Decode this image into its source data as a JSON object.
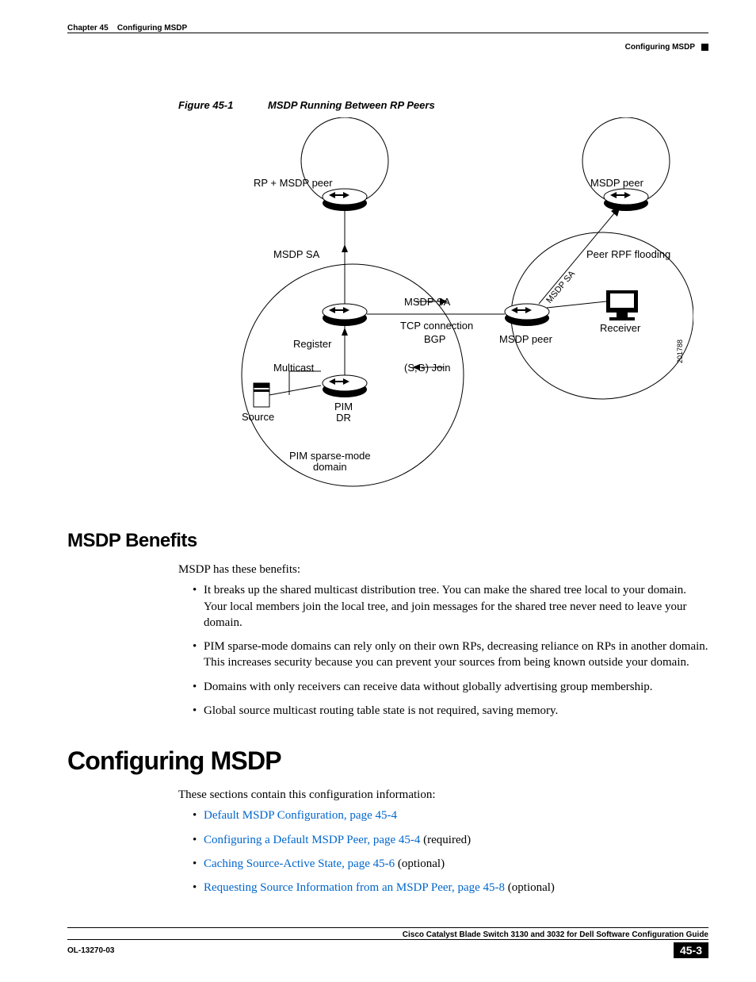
{
  "header": {
    "chapter": "Chapter 45",
    "chapter_title": "Configuring MSDP",
    "section": "Configuring MSDP"
  },
  "figure": {
    "number": "Figure 45-1",
    "title": "MSDP Running Between RP Peers",
    "labels": {
      "rp_msdp_peer": "RP + MSDP peer",
      "msdp_peer_top": "MSDP peer",
      "msdp_sa_left": "MSDP SA",
      "peer_rpf": "Peer RPF flooding",
      "msdp_sa_rot": "MSDP SA",
      "msdp_sa_mid": "MSDP SA",
      "tcp": "TCP connection",
      "bgp": "BGP",
      "msdp_peer_mid": "MSDP peer",
      "receiver": "Receiver",
      "register": "Register",
      "multicast": "Multicast",
      "sg_join": "(S,G) Join",
      "source": "Source",
      "pim_dr": "PIM\nDR",
      "pim_domain": "PIM sparse-mode\ndomain",
      "diagram_id": "201788"
    }
  },
  "benefits": {
    "heading": "MSDP Benefits",
    "intro": "MSDP has these benefits:",
    "items": [
      "It breaks up the shared multicast distribution tree. You can make the shared tree local to your domain. Your local members join the local tree, and join messages for the shared tree never need to leave your domain.",
      "PIM sparse-mode domains can rely only on their own RPs, decreasing reliance on RPs in another domain. This increases security because you can prevent your sources from being known outside your domain.",
      "Domains with only receivers can receive data without globally advertising group membership.",
      "Global source multicast routing table state is not required, saving memory."
    ]
  },
  "configuring": {
    "heading": "Configuring MSDP",
    "intro": "These sections contain this configuration information:",
    "items": [
      {
        "link": "Default MSDP Configuration, page 45-4",
        "suffix": ""
      },
      {
        "link": "Configuring a Default MSDP Peer, page 45-4",
        "suffix": " (required)"
      },
      {
        "link": "Caching Source-Active State, page 45-6",
        "suffix": " (optional)"
      },
      {
        "link": "Requesting Source Information from an MSDP Peer, page 45-8",
        "suffix": " (optional)"
      }
    ]
  },
  "footer": {
    "guide": "Cisco Catalyst Blade Switch 3130 and 3032 for Dell Software Configuration Guide",
    "doc_id": "OL-13270-03",
    "page": "45-3"
  }
}
